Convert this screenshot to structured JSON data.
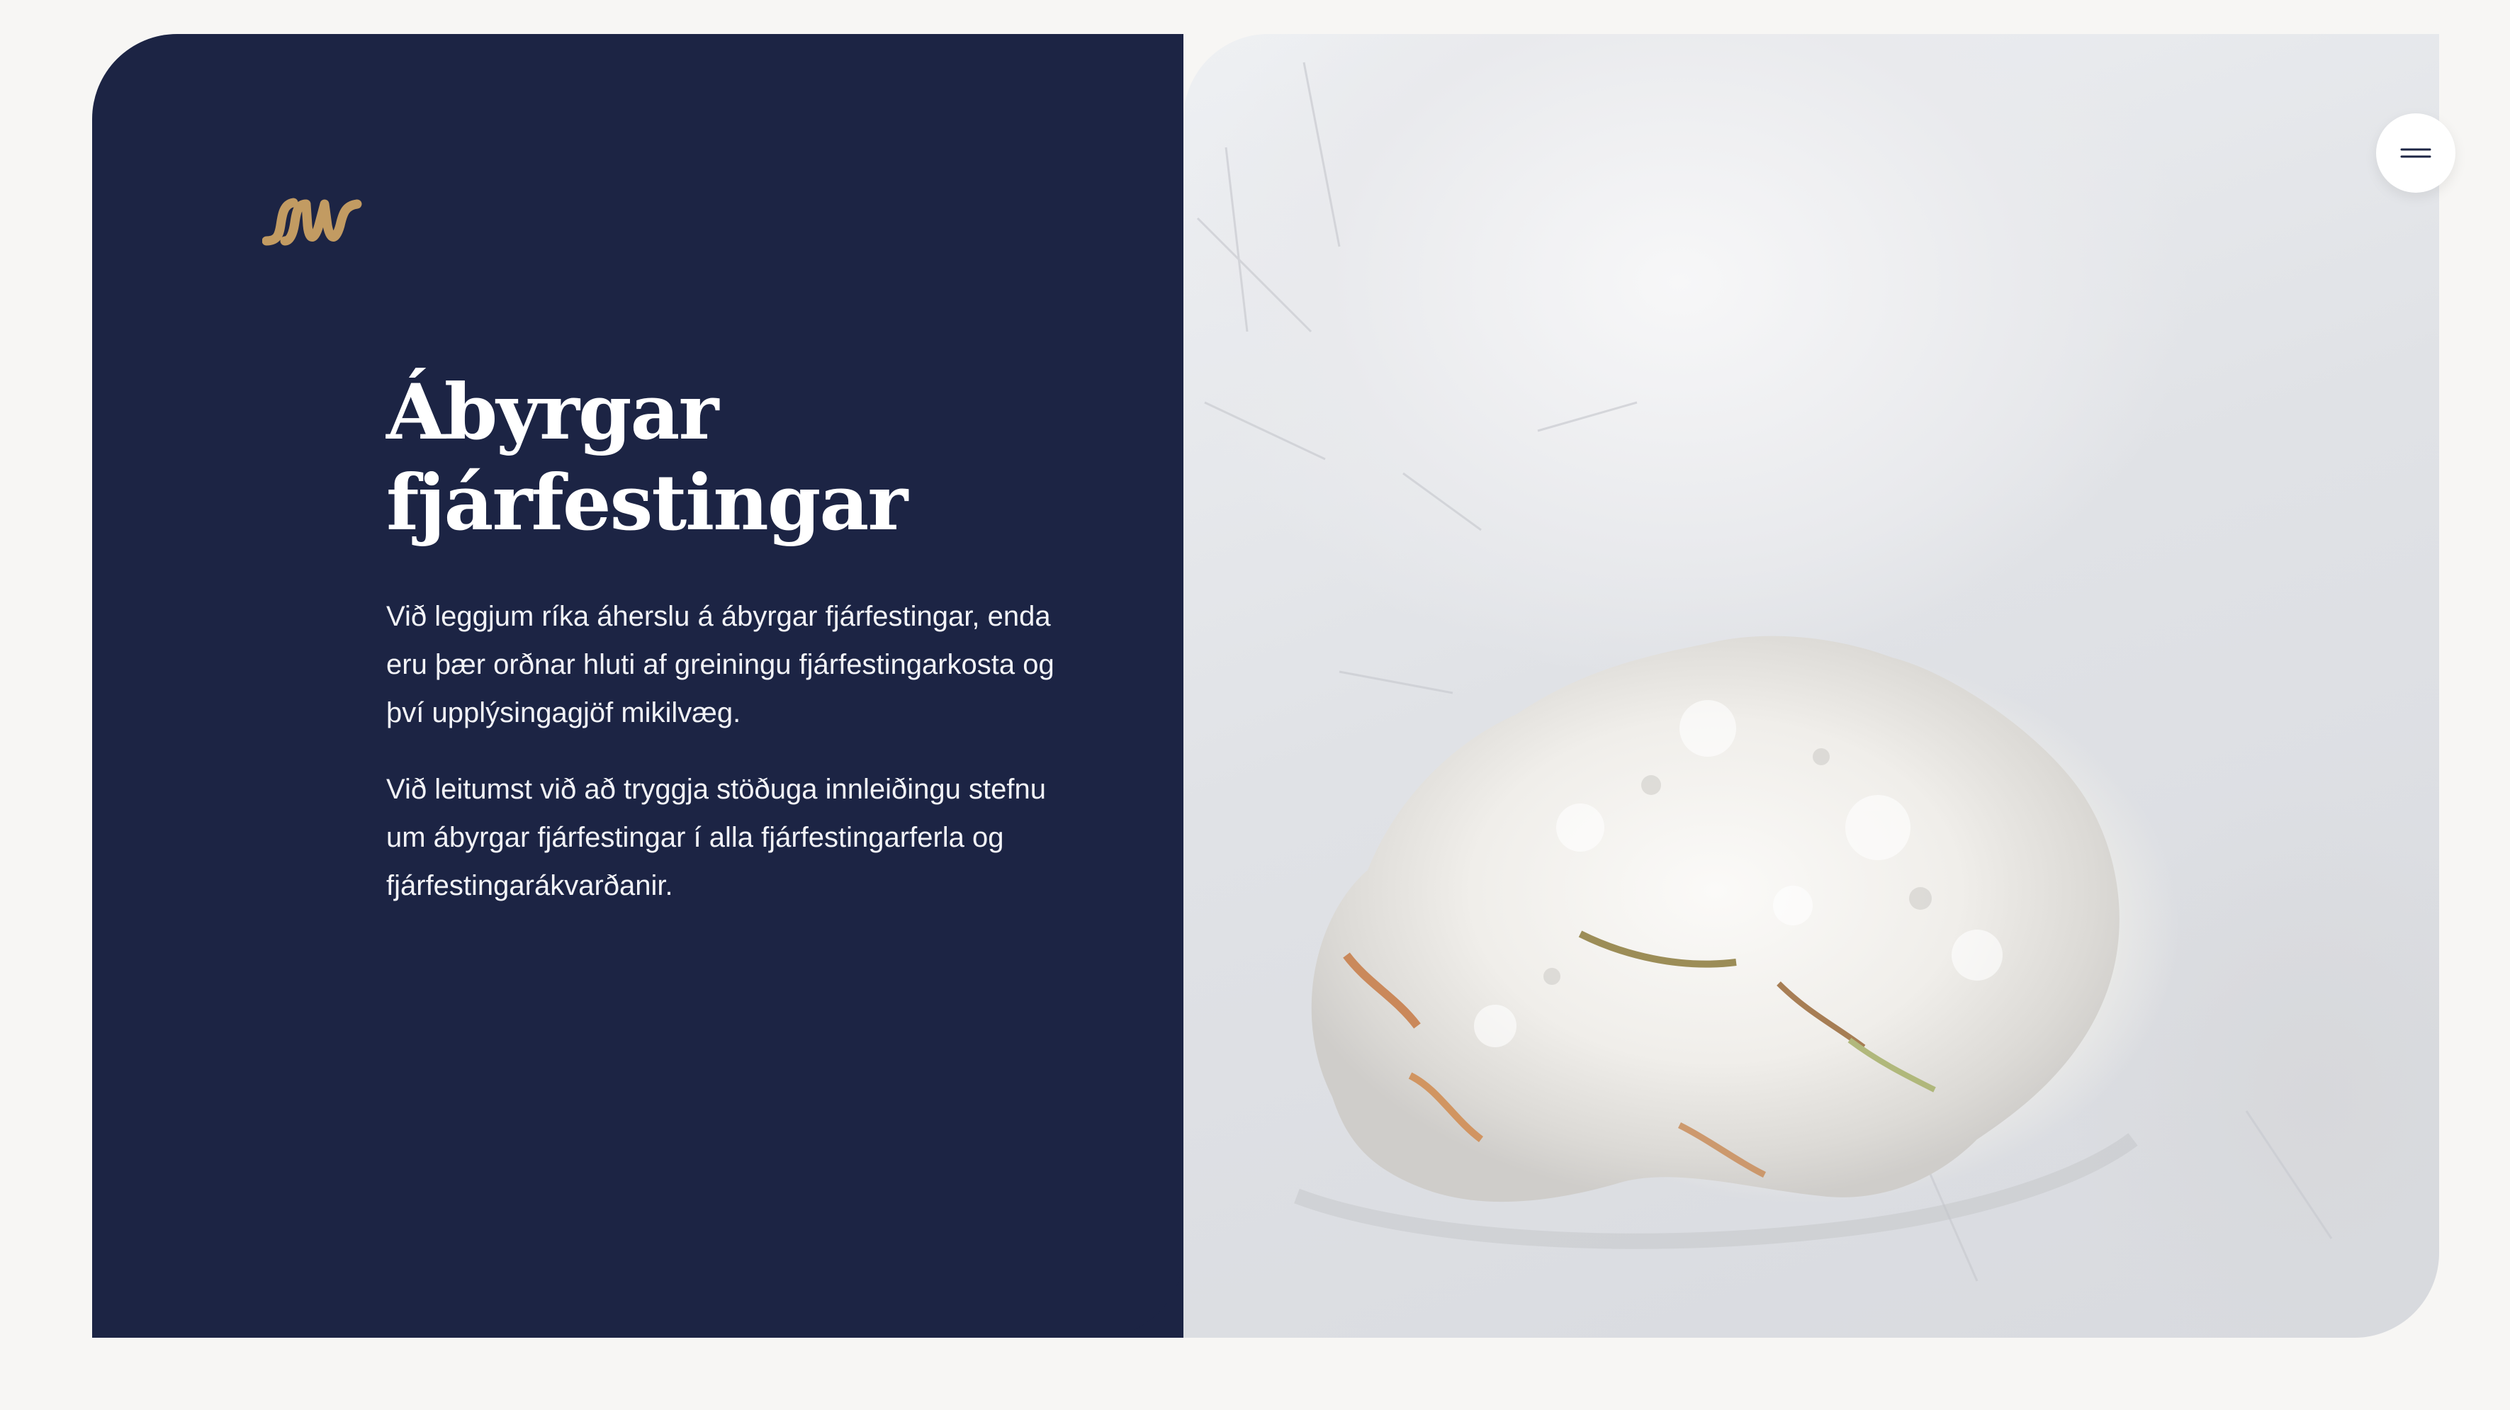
{
  "brand": {
    "logo_icon": "wave-logo-icon",
    "accent_color": "#c29b62"
  },
  "hero": {
    "title_line1": "Ábyrgar",
    "title_line2": "fjárfestingar",
    "paragraph1": "Við leggjum ríka áherslu á ábyrgar fjárfestingar, enda eru þær orðnar hluti af greiningu fjárfestingarkosta og því upplýsingagjöf mikilvæg.",
    "paragraph2": "Við leitumst við að tryggja stöðuga innleiðingu stefnu um ábyrgar fjárfestingar í alla fjárfestingarferla og fjárfestingarákvarðanir.",
    "panel_color": "#1c2444"
  },
  "menu": {
    "icon": "hamburger-menu-icon"
  },
  "image": {
    "subject": "rock-photo"
  }
}
